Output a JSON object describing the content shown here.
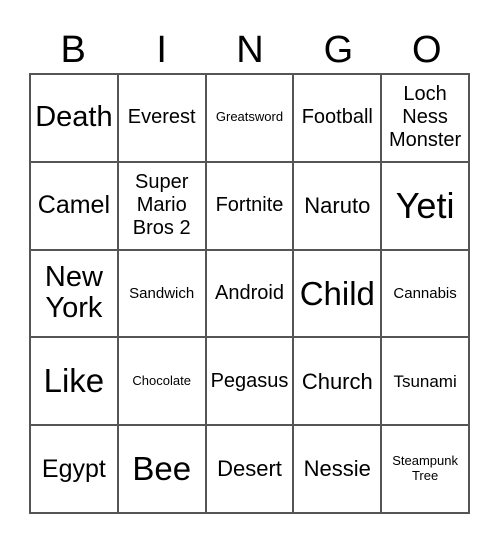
{
  "header": [
    "B",
    "I",
    "N",
    "G",
    "O"
  ],
  "cells": [
    {
      "text": "Death",
      "size": "s28"
    },
    {
      "text": "Everest",
      "size": "s20"
    },
    {
      "text": "Greatsword",
      "size": "s13"
    },
    {
      "text": "Football",
      "size": "s20"
    },
    {
      "text": "Loch Ness Monster",
      "size": "s20"
    },
    {
      "text": "Camel",
      "size": "s25"
    },
    {
      "text": "Super Mario Bros 2",
      "size": "s20"
    },
    {
      "text": "Fortnite",
      "size": "s20"
    },
    {
      "text": "Naruto",
      "size": "s22"
    },
    {
      "text": "Yeti",
      "size": "s36"
    },
    {
      "text": "New York",
      "size": "s28"
    },
    {
      "text": "Sandwich",
      "size": "s15"
    },
    {
      "text": "Android",
      "size": "s20"
    },
    {
      "text": "Child",
      "size": "s32"
    },
    {
      "text": "Cannabis",
      "size": "s15"
    },
    {
      "text": "Like",
      "size": "s32"
    },
    {
      "text": "Chocolate",
      "size": "s13"
    },
    {
      "text": "Pegasus",
      "size": "s20"
    },
    {
      "text": "Church",
      "size": "s22"
    },
    {
      "text": "Tsunami",
      "size": "s17"
    },
    {
      "text": "Egypt",
      "size": "s25"
    },
    {
      "text": "Bee",
      "size": "s32"
    },
    {
      "text": "Desert",
      "size": "s22"
    },
    {
      "text": "Nessie",
      "size": "s22"
    },
    {
      "text": "Steampunk Tree",
      "size": "s13"
    }
  ]
}
